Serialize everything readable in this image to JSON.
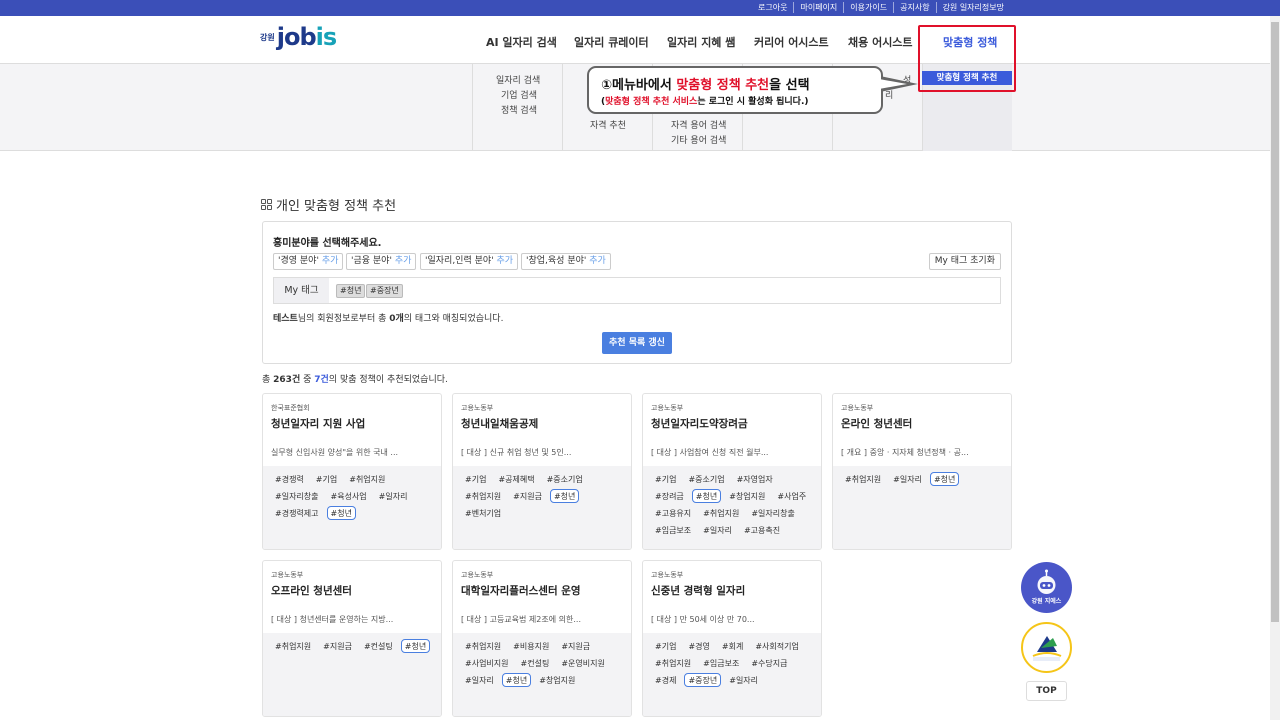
{
  "topbar": {
    "links": [
      "로그아웃",
      "마이페이지",
      "이용가이드",
      "공지사항",
      "강원 일자리정보망"
    ]
  },
  "logo": {
    "small": "강원",
    "brand_main": "job",
    "brand_accent": "is"
  },
  "nav": [
    "AI 일자리 검색",
    "일자리 큐레이터",
    "일자리 지혜 쌤",
    "커리어 어시스트",
    "채용 어시스트",
    "맞춤형 정책"
  ],
  "mega": {
    "col1": [
      "일자리 검색",
      "기업 검색",
      "정책 검색"
    ],
    "col2": [
      "자격 추천"
    ],
    "col3": [
      "자격 용어 검색",
      "기타 용어 검색"
    ],
    "col5_partial": [
      "성",
      "리"
    ],
    "selected": "맞춤형 정책 추천"
  },
  "callout": {
    "num": "①",
    "l1_pre": "메뉴바에서 ",
    "l1_red": "맞춤형 정책 추천",
    "l1_post": "을 선택",
    "l2_pre": "(",
    "l2_red": "맞춤형 정책 추천 서비스",
    "l2_post": "는 로그인 시 활성화 됩니다.)"
  },
  "section_title": "개인 맞춤형 정책 추천",
  "filter": {
    "question": "흥미분야를 선택해주세요.",
    "add_label": "추가",
    "tags": [
      "'경영 분야'",
      "'금융 분야'",
      "'일자리,인력 분야'",
      "'창업,육성 분야'"
    ],
    "reset": "My 태그 초기화",
    "mytag_label": "My 태그",
    "mytags": [
      "#청년",
      "#중장년"
    ],
    "info_user": "테스트",
    "info_mid": "님의 회원정보로부터 총 ",
    "info_count": "0개",
    "info_end": "의 태그와 매칭되었습니다.",
    "refresh": "추천 목록 갱신"
  },
  "summary": {
    "pre": "총 ",
    "total": "263건",
    "mid": " 중 ",
    "matched": "7건",
    "post": "의 맞춤 정책이 추천되었습니다."
  },
  "cards": [
    {
      "org": "한국표준협회",
      "title": "청년일자리 지원 사업",
      "desc": "실무형 신입사원 양성\"을 위한 국내 ...",
      "tags": [
        "#경쟁력",
        "#기업",
        "#취업지원",
        "#일자리창출",
        "#육성사업",
        "#일자리",
        "#경쟁력제고",
        "#청년"
      ],
      "hl": [
        "#청년"
      ]
    },
    {
      "org": "고용노동부",
      "title": "청년내일채움공제",
      "desc": "[ 대상 ] 신규 취업 청년 및 5인...",
      "tags": [
        "#기업",
        "#공제혜택",
        "#중소기업",
        "#취업지원",
        "#지원금",
        "#청년",
        "#벤처기업"
      ],
      "hl": [
        "#청년"
      ]
    },
    {
      "org": "고용노동부",
      "title": "청년일자리도약장려금",
      "desc": "[ 대상 ] 사업참여 신청 직전 월부...",
      "tags": [
        "#기업",
        "#중소기업",
        "#자영업자",
        "#장려금",
        "#청년",
        "#창업지원",
        "#사업주",
        "#고용유지",
        "#취업지원",
        "#일자리창출",
        "#임금보조",
        "#일자리",
        "#고용촉진"
      ],
      "hl": [
        "#청년"
      ]
    },
    {
      "org": "고용노동부",
      "title": "온라인 청년센터",
      "desc": "[ 개요 ] 중앙 · 지자체 청년정책 · 공...",
      "tags": [
        "#취업지원",
        "#일자리",
        "#청년"
      ],
      "hl": [
        "#청년"
      ]
    },
    {
      "org": "고용노동부",
      "title": "오프라인 청년센터",
      "desc": "[ 대상 ] 청년센터를 운영하는 지방...",
      "tags": [
        "#취업지원",
        "#지원금",
        "#컨설팅",
        "#청년"
      ],
      "hl": [
        "#청년"
      ]
    },
    {
      "org": "고용노동부",
      "title": "대학일자리플러스센터 운영",
      "desc": "[ 대상 ] 고등교육법 제2조에 의한...",
      "tags": [
        "#취업지원",
        "#비용지원",
        "#지원금",
        "#사업비지원",
        "#컨설팅",
        "#운영비지원",
        "#일자리",
        "#청년",
        "#창업지원"
      ],
      "hl": [
        "#청년"
      ]
    },
    {
      "org": "고용노동부",
      "title": "신중년 경력형 일자리",
      "desc": "[ 대상 ] 만 50세 이상 만 70...",
      "tags": [
        "#기업",
        "#경영",
        "#회계",
        "#사회적기업",
        "#취업지원",
        "#임금보조",
        "#수당지급",
        "#경제",
        "#중장년",
        "#일자리"
      ],
      "hl": [
        "#중장년"
      ]
    }
  ],
  "floating": {
    "chatbot": "강원 지에스",
    "top": "TOP"
  },
  "colors": {
    "primary": "#3b4fb8",
    "accent": "#4a7fe0",
    "highlight": "#e0102a"
  }
}
